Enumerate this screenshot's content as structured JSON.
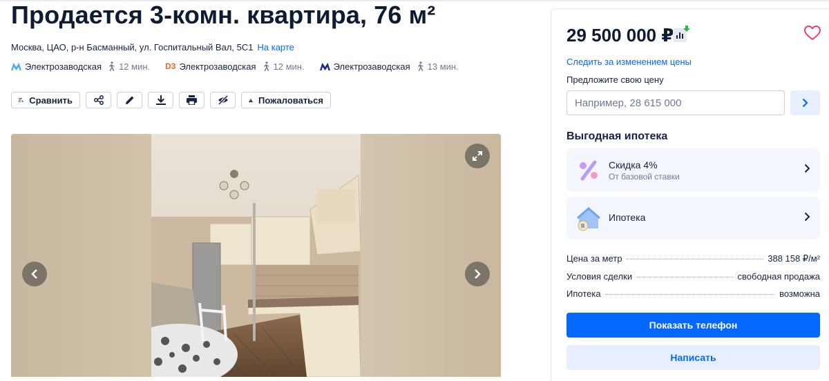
{
  "listing": {
    "title": "Продается 3-комн. квартира, 76 м²",
    "address": "Москва, ЦАО, р-н Басманный, ул. Госпитальный Вал, 5С1",
    "map_link": "На карте",
    "metro": [
      {
        "name": "Электрозаводская",
        "walk": "12 мин.",
        "logo": "М",
        "logo_icon": "moscow-metro-icon",
        "color": "#4cb1e8"
      },
      {
        "name": "Электрозаводская",
        "walk": "12 мин.",
        "logo": "D3",
        "logo_icon": "mcd-d3-icon",
        "color": "#e9692c"
      },
      {
        "name": "Электрозаводская",
        "walk": "13 мин.",
        "logo": "М",
        "logo_icon": "moscow-metro-icon",
        "color": "#1a2b8c"
      }
    ]
  },
  "toolbar": {
    "compare_label": "Сравнить",
    "complain_label": "Пожаловаться",
    "icons": [
      "compare-icon",
      "share-icon",
      "edit-icon",
      "download-icon",
      "print-icon",
      "hide-icon",
      "warning-icon"
    ]
  },
  "gallery": {
    "icons": [
      "expand-icon",
      "arrow-left-icon",
      "arrow-right-icon"
    ]
  },
  "sidebar": {
    "price": "29 500 000 ₽",
    "follow_price": "Следить за изменением цены",
    "offer_label": "Предложите свою цену",
    "offer_placeholder": "Например, 28 615 000",
    "mortgage_title": "Выгодная ипотека",
    "cards": [
      {
        "title": "Скидка 4%",
        "subtitle": "От базовой ставки",
        "icon": "percent-icon"
      },
      {
        "title": "Ипотека",
        "subtitle": "",
        "icon": "house-icon"
      }
    ],
    "facts": [
      {
        "label": "Цена за метр",
        "value": "388 158 ₽/м²"
      },
      {
        "label": "Условия сделки",
        "value": "свободная продажа"
      },
      {
        "label": "Ипотека",
        "value": "возможна"
      }
    ],
    "show_phone": "Показать телефон",
    "write": "Написать"
  },
  "colors": {
    "accent": "#0468ff",
    "accent_light": "#e7efff",
    "heart": "#e84260",
    "text": "#152242"
  }
}
